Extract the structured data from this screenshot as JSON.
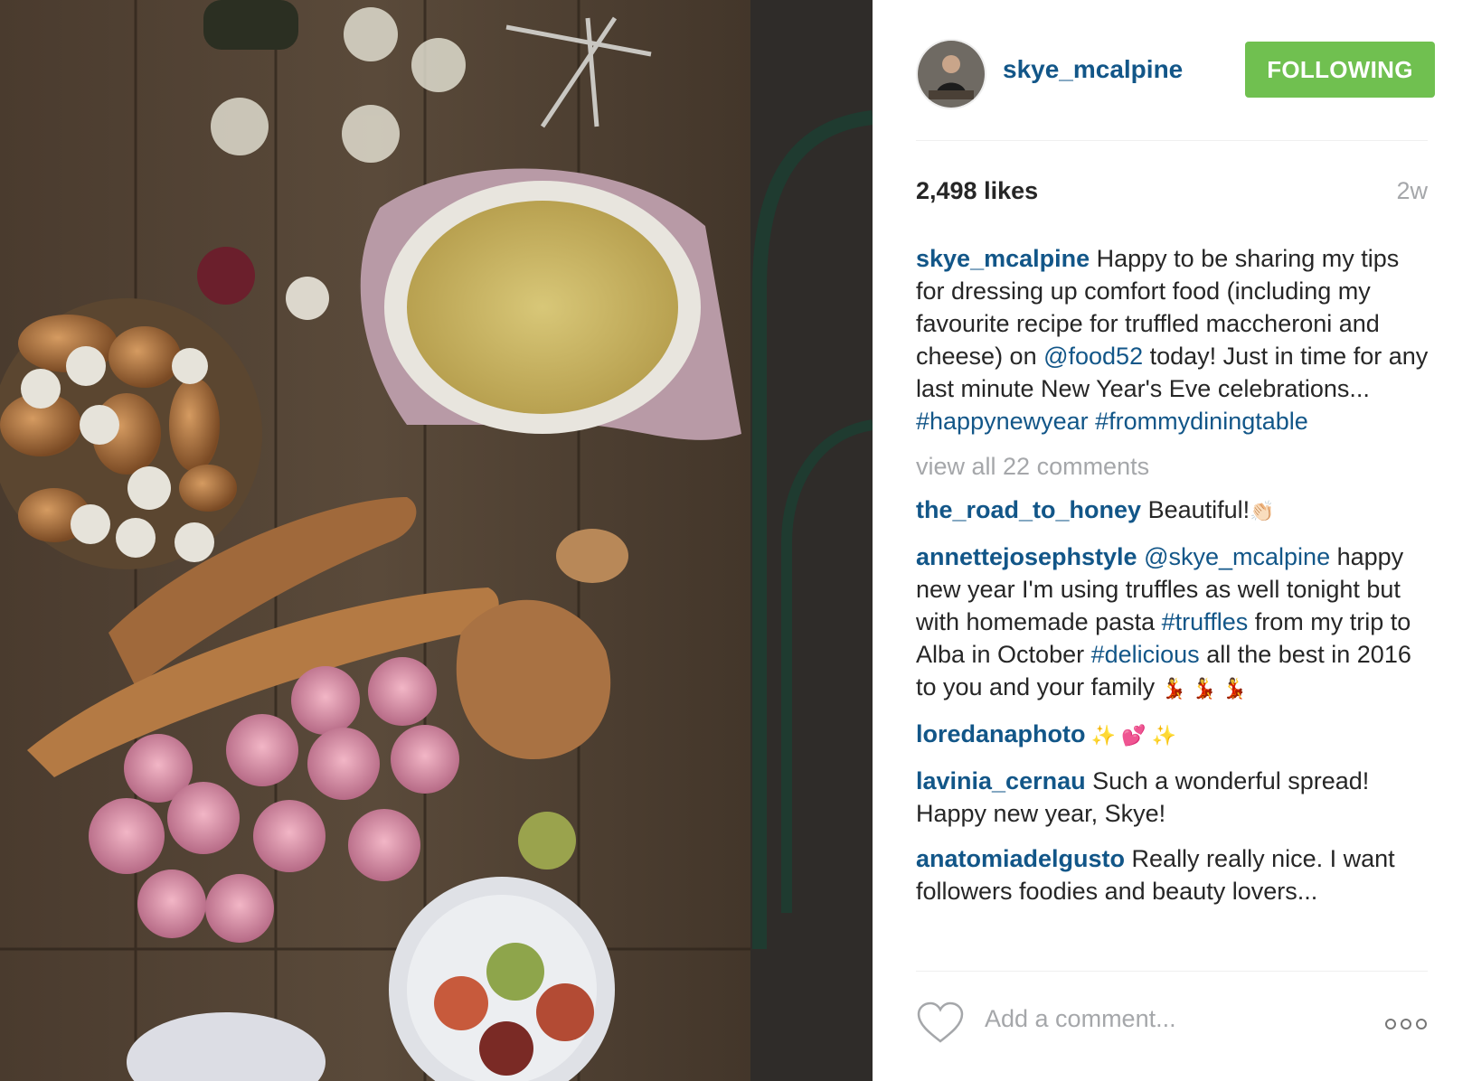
{
  "post": {
    "photo_alt": "photo"
  },
  "header": {
    "username": "skye_mcalpine",
    "follow_button": "FOLLOWING"
  },
  "stats": {
    "likes": "2,498 likes",
    "time_ago": "2w"
  },
  "caption": {
    "user": "skye_mcalpine",
    "text_1": " Happy to be sharing my tips for dressing up comfort food (including my favourite recipe for truffled maccheroni and cheese) on ",
    "mention": "@food52",
    "text_2": " today! Just in time for any last minute New Year's Eve celebrations... ",
    "hashtag_1": "#happynewyear",
    "hashtag_2": "#frommydiningtable"
  },
  "view_all_comments": "view all 22 comments",
  "comments": [
    {
      "user": "the_road_to_honey",
      "text": " Beautiful!",
      "emoji": "👏🏻"
    },
    {
      "user": "annettejosephstyle",
      "mention": "@skye_mcalpine",
      "text_1": " happy new year I'm using truffles as well tonight but with homemade pasta ",
      "hashtag_1": "#truffles",
      "text_2": " from my trip to Alba in October ",
      "hashtag_2": "#delicious",
      "text_3": " all the best in 2016 to you and your family ",
      "emoji": "💃 💃 💃"
    },
    {
      "user": "loredanaphoto",
      "emoji": " ✨ 💕 ✨"
    },
    {
      "user": "lavinia_cernau",
      "text": " Such a wonderful spread! Happy new year, Skye!"
    },
    {
      "user": "anatomiadelgusto",
      "text": " Really really nice. I want followers foodies and beauty lovers..."
    }
  ],
  "comment_box": {
    "placeholder": "Add a comment..."
  },
  "icons": {
    "like": "heart-icon",
    "more": "more-options-icon"
  },
  "colors": {
    "follow_button": "#70c050",
    "username": "#125688",
    "muted": "#a5a7aa"
  }
}
